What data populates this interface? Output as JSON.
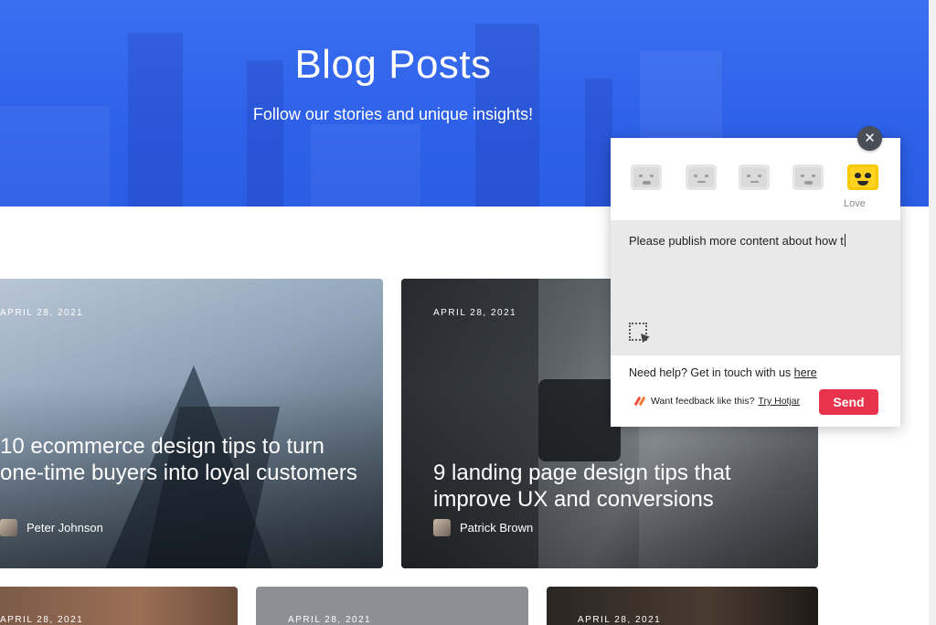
{
  "hero": {
    "title": "Blog Posts",
    "subtitle": "Follow our stories and unique insights!"
  },
  "posts": [
    {
      "date": "APRIL 28, 2021",
      "title": "10 ecommerce design tips to turn one-time buyers into loyal customers",
      "author": "Peter Johnson"
    },
    {
      "date": "APRIL 28, 2021",
      "title": "9 landing page design tips that improve UX and conversions",
      "author": "Patrick Brown"
    },
    {
      "date": "APRIL 28, 2021"
    },
    {
      "date": "APRIL 28, 2021"
    },
    {
      "date": "APRIL 28, 2021"
    }
  ],
  "widget": {
    "emotes": [
      "hate-icon",
      "dislike-icon",
      "neutral-icon",
      "like-icon",
      "love-icon"
    ],
    "selected_label": "Love",
    "feedback_text": "Please publish more content about how t",
    "help_text": "Need help? Get in touch with us ",
    "help_link": "here",
    "footer_text": "Want feedback like this?",
    "footer_link": "Try Hotjar",
    "send_label": "Send",
    "close_label": "✕"
  },
  "colors": {
    "hero_blue": "#2f62ea",
    "send_red": "#e8334c",
    "love_yellow": "#ffd21f"
  }
}
